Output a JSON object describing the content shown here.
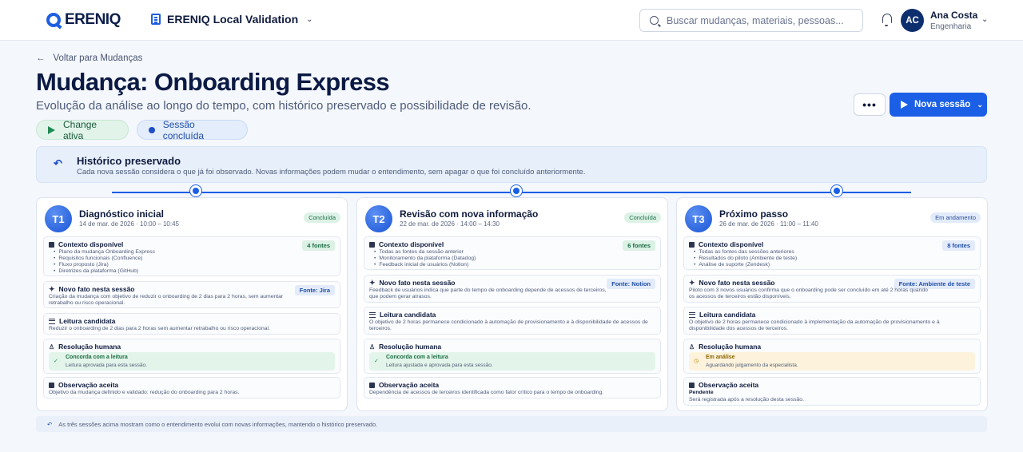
{
  "brand": {
    "name": "ERENIQ"
  },
  "workspace": {
    "label": "ERENIQ Local Validation"
  },
  "search": {
    "placeholder": "Buscar mudanças, materiais, pessoas..."
  },
  "user": {
    "initials": "AC",
    "name": "Ana Costa",
    "role": "Engenharia"
  },
  "header": {
    "back_label": "Voltar para Mudanças",
    "title": "Mudança: Onboarding Express",
    "subtitle": "Evolução da análise ao longo do tempo, com histórico preservado e possibilidade de revisão.",
    "pills": {
      "change": "Change ativa",
      "session": "Sessão concluída"
    },
    "more_label": "•••",
    "new_session_label": "Nova sessão"
  },
  "banner": {
    "title": "Histórico preservado",
    "text": "Cada nova sessão considera o que já foi observado. Novas informações podem mudar o entendimento, sem apagar o que foi concluído anteriormente."
  },
  "cards": [
    {
      "badge": "T1",
      "title": "Diagnóstico inicial",
      "date": "14 de mar. de 2026 · 10:00 – 10:45",
      "status": "Concluída",
      "context": {
        "label": "Contexto disponível",
        "count": "4 fontes",
        "items": [
          "Plano da mudança Onboarding Express",
          "Requisitos funcionais (Confluence)",
          "Fluxo proposto (Jira)",
          "Diretrizes da plataforma (GitHub)"
        ]
      },
      "fact": {
        "label": "Novo fato nesta sessão",
        "source": "Fonte: Jira",
        "text": "Criação da mudança com objetivo de reduzir o onboarding de 2 dias para 2 horas, sem aumentar retrabalho ou risco operacional."
      },
      "reading": {
        "label": "Leitura candidata",
        "text": "Reduzir o onboarding de 2 dias para 2 horas sem aumentar retrabalho ou risco operacional."
      },
      "resolution": {
        "label": "Resolução humana",
        "title": "Concorda com a leitura",
        "sub": "Leitura aprovada para esta sessão."
      },
      "observation": {
        "label": "Observação aceita",
        "text": "Objetivo da mudança definido e validado: redução do onboarding para 2 horas."
      }
    },
    {
      "badge": "T2",
      "title": "Revisão com nova informação",
      "date": "22 de mar. de 2026 · 14:00 – 14:30",
      "status": "Concluída",
      "context": {
        "label": "Contexto disponível",
        "count": "6 fontes",
        "items": [
          "Todas as fontes da sessão anterior",
          "Monitoramento da plataforma (Datadog)",
          "Feedback inicial de usuários (Notion)"
        ]
      },
      "fact": {
        "label": "Novo fato nesta sessão",
        "source": "Fonte: Notion",
        "text": "Feedback de usuários indica que parte do tempo de onboarding depende de acessos de terceiros, que podem gerar atrasos."
      },
      "reading": {
        "label": "Leitura candidata",
        "text": "O objetivo de 2 horas permanece condicionado à automação de provisionamento e à disponibilidade de acessos de terceiros."
      },
      "resolution": {
        "label": "Resolução humana",
        "title": "Concorda com a leitura",
        "sub": "Leitura ajustada e aprovada para esta sessão."
      },
      "observation": {
        "label": "Observação aceita",
        "text": "Dependência de acessos de terceiros identificada como fator crítico para o tempo de onboarding."
      }
    },
    {
      "badge": "T3",
      "title": "Próximo passo",
      "date": "26 de mar. de 2026 · 11:00 – 11:40",
      "status": "Em andamento",
      "context": {
        "label": "Contexto disponível",
        "count": "8 fontes",
        "items": [
          "Todas as fontes das sessões anteriores",
          "Resultados do piloto (Ambiente de teste)",
          "Análise de suporte (Zendesk)"
        ]
      },
      "fact": {
        "label": "Novo fato nesta sessão",
        "source": "Fonte: Ambiente de teste",
        "text": "Piloto com 3 novos usuários confirma que o onboarding pode ser concluído em até 2 horas quando os acessos de terceiros estão disponíveis."
      },
      "reading": {
        "label": "Leitura candidata",
        "text": "O objetivo de 2 horas permanece condicionado à implementação da automação de provisionamento e à disponibilidade dos acessos de terceiros."
      },
      "resolution": {
        "label": "Resolução humana",
        "title": "Em análise",
        "sub": "Aguardando julgamento da especialista."
      },
      "observation": {
        "label": "Observação aceita",
        "status": "Pendente",
        "text": "Será registrada após a resolução desta sessão."
      }
    }
  ],
  "footer": {
    "note": "As três sessões acima mostram como o entendimento evolui com novas informações, mantendo o histórico preservado."
  },
  "colors": {
    "accent": "#1a5fe6",
    "success": "#1f8a52",
    "warning": "#b98500",
    "navy": "#0b1a44"
  }
}
